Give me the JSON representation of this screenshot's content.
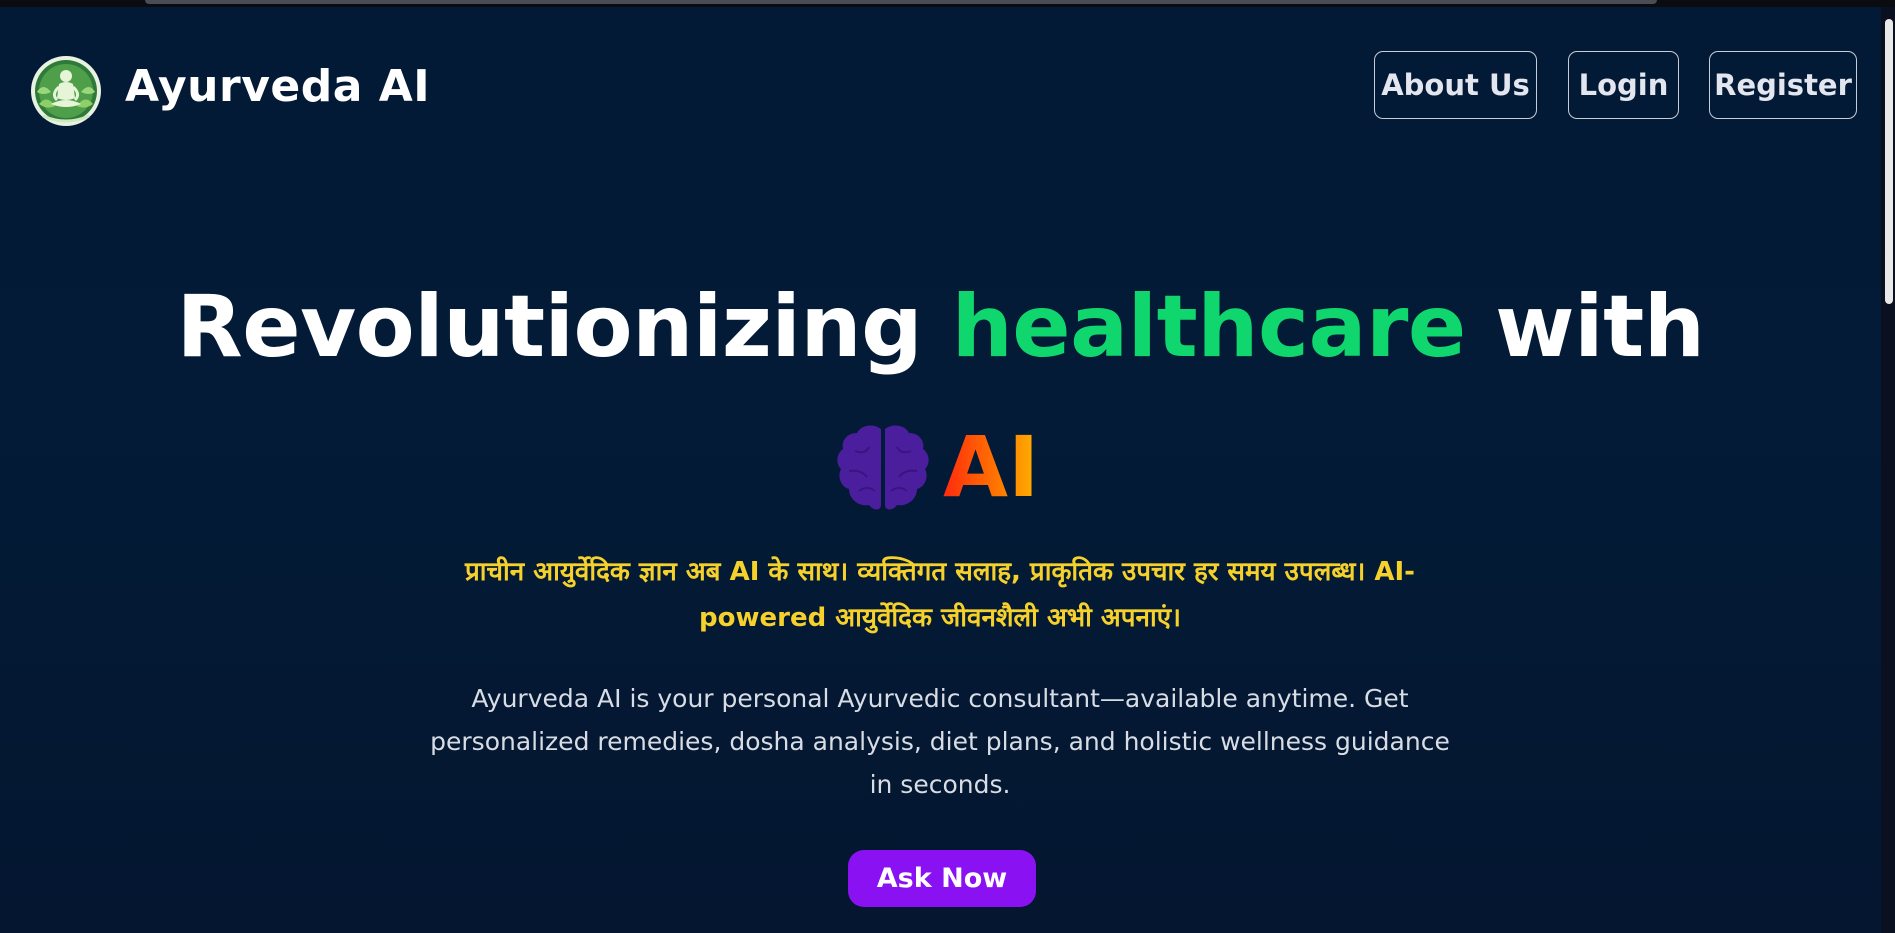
{
  "header": {
    "brand": "Ayurveda AI",
    "logo_icon": "meditation-logo-icon",
    "nav": [
      {
        "label": "About Us"
      },
      {
        "label": "Login"
      },
      {
        "label": "Register"
      }
    ]
  },
  "hero": {
    "headline_part1": "Revolutionizing ",
    "headline_highlight": "healthcare",
    "headline_part2": " with",
    "ai_icon": "brain-icon",
    "ai_word": "AI",
    "hindi_tagline": "प्राचीन आयुर्वेदिक ज्ञान अब AI के साथ। व्यक्तिगत सलाह, प्राकृतिक उपचार हर समय उपलब्ध। AI-powered आयुर्वेदिक जीवनशैली अभी अपनाएं।",
    "description": "Ayurveda AI is your personal Ayurvedic consultant—available anytime. Get personalized remedies, dosha analysis, diet plans, and holistic wellness guidance in seconds.",
    "cta_label": "Ask Now"
  },
  "colors": {
    "background": "#031b37",
    "highlight": "#10d66e",
    "hindi_text": "#f6d12b",
    "cta": "#8a12f2",
    "brain": "#4b1e9e"
  }
}
